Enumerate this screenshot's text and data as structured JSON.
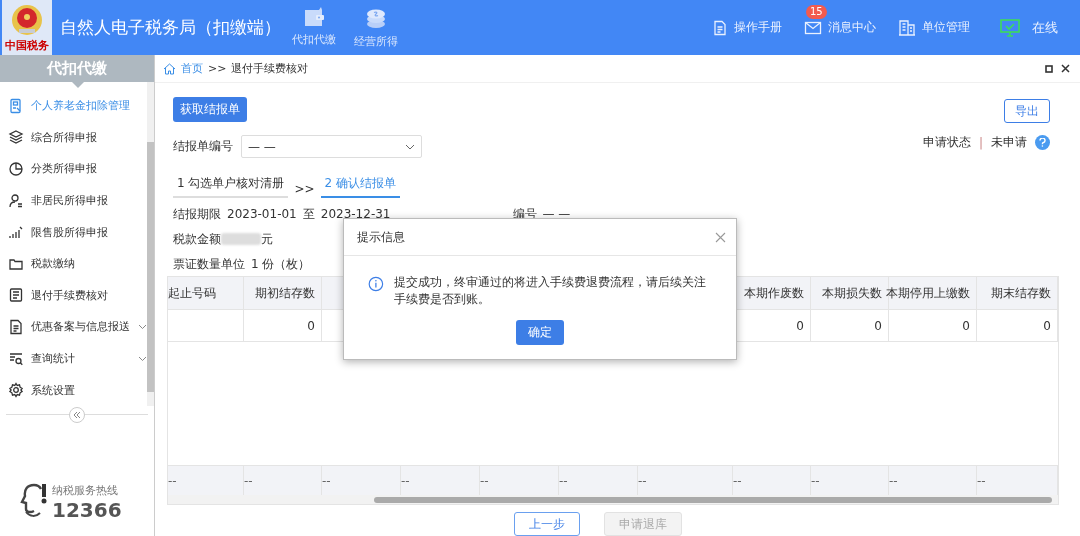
{
  "header": {
    "title": "自然人电子税务局（扣缴端）",
    "logo_caption": "中国税务",
    "nav": [
      {
        "label": "代扣代缴",
        "kind": "wallet"
      },
      {
        "label": "经营所得",
        "kind": "coins"
      }
    ],
    "tools": [
      {
        "label": "操作手册",
        "kind": "doc"
      },
      {
        "label": "消息中心",
        "kind": "mail",
        "badge": "15"
      },
      {
        "label": "单位管理",
        "kind": "building"
      },
      {
        "label": "在线",
        "kind": "online"
      }
    ]
  },
  "sidebar": {
    "title": "代扣代缴",
    "items": [
      {
        "label": "个人养老金扣除管理",
        "kind": "pension",
        "selected": true,
        "expandable": false
      },
      {
        "label": "综合所得申报",
        "kind": "layers",
        "selected": false,
        "expandable": false
      },
      {
        "label": "分类所得申报",
        "kind": "pie",
        "selected": false,
        "expandable": false
      },
      {
        "label": "非居民所得申报",
        "kind": "person",
        "selected": false,
        "expandable": false
      },
      {
        "label": "限售股所得申报",
        "kind": "bars",
        "selected": false,
        "expandable": false
      },
      {
        "label": "税款缴纳",
        "kind": "folder",
        "selected": false,
        "expandable": false
      },
      {
        "label": "退付手续费核对",
        "kind": "list",
        "selected": false,
        "expandable": false
      },
      {
        "label": "优惠备案与信息报送",
        "kind": "doc",
        "selected": false,
        "expandable": true
      },
      {
        "label": "查询统计",
        "kind": "search",
        "selected": false,
        "expandable": true
      },
      {
        "label": "系统设置",
        "kind": "gear",
        "selected": false,
        "expandable": false
      }
    ],
    "hotline_label": "纳税服务热线",
    "hotline_number": "12366"
  },
  "breadcrumb": {
    "home": "首页",
    "separator": ">>",
    "current": "退付手续费核对"
  },
  "actions": {
    "fetch": "获取结报单",
    "export": "导出"
  },
  "report_select": {
    "label": "结报单编号",
    "value": "— —"
  },
  "status": {
    "label": "申请状态",
    "separator": "|",
    "value": "未申请"
  },
  "steps": [
    {
      "label": "1 勾选单户核对清册",
      "selected": false
    },
    {
      "label": "2 确认结报单",
      "selected": true
    }
  ],
  "step_separator": ">>",
  "info": {
    "period_label": "结报期限",
    "period_start": "2023-01-01",
    "period_to": "至",
    "period_end": "2023-12-31",
    "number_label": "编号",
    "number_value": "— —",
    "tax_label": "税款金额",
    "tax_unit": "元",
    "unit_label": "票证数量单位",
    "unit_value": "1 份（枚）"
  },
  "table": {
    "columns": [
      "起止号码",
      "期初结存数",
      null,
      null,
      null,
      null,
      null,
      "本期作废数",
      "本期损失数",
      "本期停用上缴数",
      "期末结存数"
    ],
    "rows": [
      [
        null,
        "0",
        null,
        null,
        null,
        null,
        null,
        "0",
        "0",
        "0",
        "0"
      ]
    ],
    "footer": [
      "--",
      "--",
      "--",
      "--",
      "--",
      "--",
      "--",
      "--",
      "--",
      "--",
      "--"
    ]
  },
  "buttons": [
    {
      "label": "上一步",
      "disabled": false
    },
    {
      "label": "申请退库",
      "disabled": true
    }
  ],
  "dialog": {
    "title": "提示信息",
    "message": "提交成功，终审通过的将进入手续费退费流程，请后续关注手续费是否到账。",
    "confirm": "确定"
  }
}
